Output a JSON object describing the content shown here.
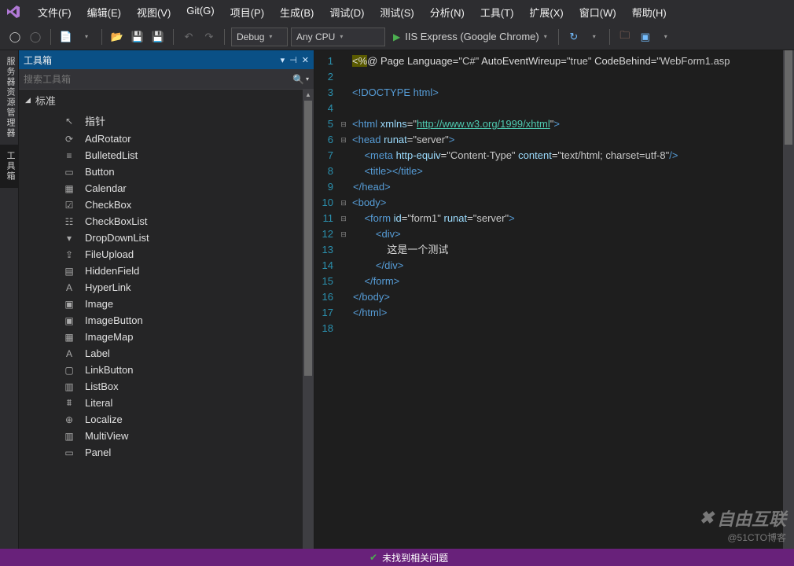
{
  "menu": [
    "文件(F)",
    "编辑(E)",
    "视图(V)",
    "Git(G)",
    "项目(P)",
    "生成(B)",
    "调试(D)",
    "测试(S)",
    "分析(N)",
    "工具(T)",
    "扩展(X)",
    "窗口(W)",
    "帮助(H)"
  ],
  "toolbar": {
    "config": "Debug",
    "platform": "Any CPU",
    "run_label": "IIS Express (Google Chrome)"
  },
  "side_tabs": [
    "服务器资源管理器",
    "工具箱"
  ],
  "toolbox": {
    "title": "工具箱",
    "search_placeholder": "搜索工具箱",
    "group": "标准",
    "items": [
      {
        "ico": "↖",
        "label": "指针"
      },
      {
        "ico": "⟳",
        "label": "AdRotator"
      },
      {
        "ico": "≡",
        "label": "BulletedList"
      },
      {
        "ico": "▭",
        "label": "Button"
      },
      {
        "ico": "▦",
        "label": "Calendar"
      },
      {
        "ico": "☑",
        "label": "CheckBox"
      },
      {
        "ico": "☷",
        "label": "CheckBoxList"
      },
      {
        "ico": "▾",
        "label": "DropDownList"
      },
      {
        "ico": "⇪",
        "label": "FileUpload"
      },
      {
        "ico": "▤",
        "label": "HiddenField"
      },
      {
        "ico": "A",
        "label": "HyperLink"
      },
      {
        "ico": "▣",
        "label": "Image"
      },
      {
        "ico": "▣",
        "label": "ImageButton"
      },
      {
        "ico": "▦",
        "label": "ImageMap"
      },
      {
        "ico": "A",
        "label": "Label"
      },
      {
        "ico": "▢",
        "label": "LinkButton"
      },
      {
        "ico": "▥",
        "label": "ListBox"
      },
      {
        "ico": "⩩",
        "label": "Literal"
      },
      {
        "ico": "⊕",
        "label": "Localize"
      },
      {
        "ico": "▥",
        "label": "MultiView"
      },
      {
        "ico": "▭",
        "label": "Panel"
      }
    ]
  },
  "editor": {
    "lines": [
      {
        "n": 1,
        "fold": "",
        "html": "<span class='c-yel'>&lt;%</span><span class='c-txt'>@ Page Language=</span><span class='c-str'>\"C#\"</span><span class='c-txt'> AutoEventWireup=</span><span class='c-str'>\"true\"</span><span class='c-txt'> CodeBehind=</span><span class='c-str'>\"WebForm1.asp</span>"
      },
      {
        "n": 2,
        "fold": "",
        "html": ""
      },
      {
        "n": 3,
        "fold": "",
        "html": "<span class='c-tag'>&lt;!DOCTYPE</span> <span class='c-tag'>html&gt;</span>"
      },
      {
        "n": 4,
        "fold": "",
        "html": ""
      },
      {
        "n": 5,
        "fold": "⊟",
        "html": "<span class='c-tag'>&lt;html</span> <span class='c-attr'>xmlns</span><span class='c-txt'>=</span><span class='c-str'>\"</span><span class='c-url'>http://www.w3.org/1999/xhtml</span><span class='c-str'>\"</span><span class='c-tag'>&gt;</span>"
      },
      {
        "n": 6,
        "fold": "⊟",
        "html": "<span class='c-tag'>&lt;head</span> <span class='c-attr'>runat</span><span class='c-txt'>=</span><span class='c-str'>\"server\"</span><span class='c-tag'>&gt;</span>"
      },
      {
        "n": 7,
        "fold": "",
        "html": "<span class='code-line-guide'></span>    <span class='c-tag'>&lt;meta</span> <span class='c-attr'>http-equiv</span><span class='c-txt'>=</span><span class='c-str'>\"Content-Type\"</span> <span class='c-attr'>content</span><span class='c-txt'>=</span><span class='c-str'>\"text/html; charset=utf-8\"</span><span class='c-tag'>/&gt;</span>"
      },
      {
        "n": 8,
        "fold": "",
        "html": "<span class='code-line-guide'></span>    <span class='c-tag'>&lt;title&gt;&lt;/title&gt;</span>"
      },
      {
        "n": 9,
        "fold": "",
        "html": "<span class='code-line-guide'></span><span class='c-tag'>&lt;/head&gt;</span>"
      },
      {
        "n": 10,
        "fold": "⊟",
        "html": "<span class='c-tag'>&lt;body&gt;</span>"
      },
      {
        "n": 11,
        "fold": "⊟",
        "html": "<span class='code-line-guide'></span>    <span class='c-tag'>&lt;form</span> <span class='c-attr'>id</span><span class='c-txt'>=</span><span class='c-str'>\"form1\"</span> <span class='c-attr'>runat</span><span class='c-txt'>=</span><span class='c-str'>\"server\"</span><span class='c-tag'>&gt;</span>"
      },
      {
        "n": 12,
        "fold": "⊟",
        "html": "<span class='code-line-guide'></span>        <span class='c-tag'>&lt;div&gt;</span>"
      },
      {
        "n": 13,
        "fold": "",
        "html": "<span class='code-line-guide'></span>            这是一个测试"
      },
      {
        "n": 14,
        "fold": "",
        "html": "<span class='code-line-guide'></span>        <span class='c-tag'>&lt;/div&gt;</span>"
      },
      {
        "n": 15,
        "fold": "",
        "html": "<span class='code-line-guide'></span>    <span class='c-tag'>&lt;/form&gt;</span>"
      },
      {
        "n": 16,
        "fold": "",
        "html": "<span class='code-line-guide'></span><span class='c-tag'>&lt;/body&gt;</span>"
      },
      {
        "n": 17,
        "fold": "",
        "html": "<span class='code-line-guide'></span><span class='c-tag'>&lt;/html&gt;</span>"
      },
      {
        "n": 18,
        "fold": "",
        "html": ""
      }
    ]
  },
  "status": {
    "msg": "未找到相关问题"
  },
  "watermark": {
    "brand": "自由互联",
    "sub": "@51CTO博客"
  }
}
